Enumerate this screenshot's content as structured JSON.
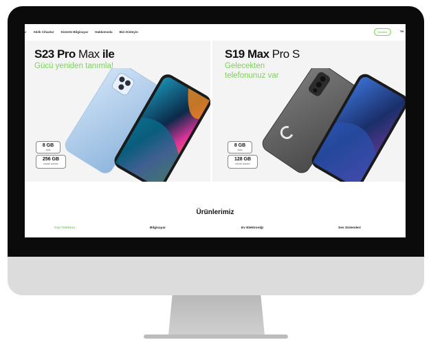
{
  "nav": {
    "links": [
      "ar",
      "Akıllı Cihazlar",
      "Dizüstü Bilgisayar",
      "Hakkımızda",
      "Bizi Dinleyin"
    ],
    "button_label": "Destek",
    "cut_text": "Ye"
  },
  "promos": [
    {
      "title_bold": "S23 Pro",
      "title_thin": " Max ",
      "title_bold2": "ile",
      "subtitle": "Gücü yeniden tanımla!",
      "specs": [
        {
          "big": "8 GB",
          "small": "RAM"
        },
        {
          "big": "256 GB",
          "small": "DAHİLİ HAFIZA"
        }
      ],
      "colors": {
        "back": "#9cc4ea",
        "screen_accent": "#e0349a"
      }
    },
    {
      "title_bold": "S19 Max",
      "title_thin": " Pro S",
      "subtitle_line1": "Gelecekten",
      "subtitle_line2": "telefonunuz var",
      "specs": [
        {
          "big": "8 GB",
          "small": "RAM"
        },
        {
          "big": "128 GB",
          "small": "DAHİLİ HAFIZA"
        }
      ],
      "colors": {
        "back": "#5a5a5a",
        "screen_accent": "#3a6fd0"
      }
    }
  ],
  "section_title": "Ürünlerimiz",
  "categories": [
    {
      "label": "Cep Telefonu",
      "color": "#7cd15a"
    },
    {
      "label": "Bilgisayar",
      "color": "#222222"
    },
    {
      "label": "Ev Elektroniği",
      "color": "#222222"
    },
    {
      "label": "Ses Sistemleri",
      "color": "#222222"
    }
  ]
}
